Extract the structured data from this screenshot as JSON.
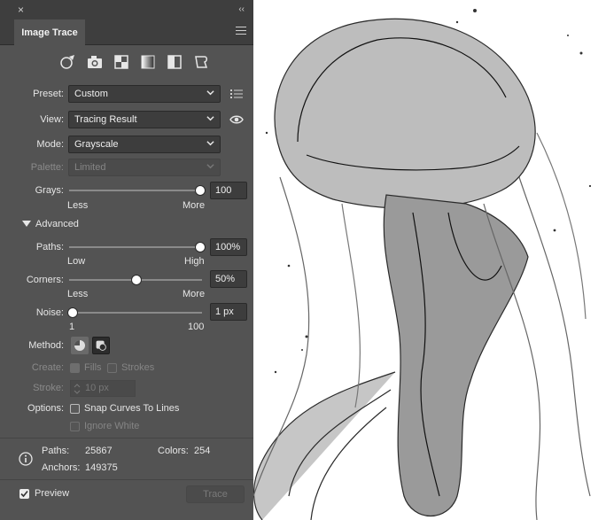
{
  "panel": {
    "close_glyph": "×",
    "collapse_glyph": "‹‹",
    "tab_label": "Image Trace",
    "preset_icons": [
      "auto-color-icon",
      "high-color-icon",
      "low-color-icon",
      "grayscale-icon",
      "black-white-icon",
      "outline-icon"
    ]
  },
  "preset": {
    "label": "Preset:",
    "value": "Custom"
  },
  "view": {
    "label": "View:",
    "value": "Tracing Result"
  },
  "mode": {
    "label": "Mode:",
    "value": "Grayscale"
  },
  "palette": {
    "label": "Palette:",
    "value": "Limited"
  },
  "grays": {
    "label": "Grays:",
    "value": "100",
    "min": "Less",
    "max": "More",
    "level": 1.0
  },
  "advanced": {
    "label": "Advanced"
  },
  "paths": {
    "label": "Paths:",
    "value": "100%",
    "min": "Low",
    "max": "High",
    "level": 1.0
  },
  "corners": {
    "label": "Corners:",
    "value": "50%",
    "min": "Less",
    "max": "More",
    "level": 0.5
  },
  "noise": {
    "label": "Noise:",
    "value": "1 px",
    "min": "1",
    "max": "100",
    "level": 0.0
  },
  "method": {
    "label": "Method:"
  },
  "create": {
    "label": "Create:",
    "fills": "Fills",
    "strokes": "Strokes"
  },
  "stroke": {
    "label": "Stroke:",
    "value": "10 px"
  },
  "options": {
    "label": "Options:",
    "snap": "Snap Curves To Lines",
    "ignore_white": "Ignore White"
  },
  "stats": {
    "paths_label": "Paths:",
    "paths_value": "25867",
    "colors_label": "Colors:",
    "colors_value": "254",
    "anchors_label": "Anchors:",
    "anchors_value": "149375"
  },
  "footer": {
    "preview_label": "Preview",
    "trace_label": "Trace"
  },
  "colors": {
    "panel_bg": "#535353",
    "header_bg": "#3e3e3e",
    "field_bg": "#3d3d3d",
    "canvas_edge": "#2f5fd0"
  }
}
